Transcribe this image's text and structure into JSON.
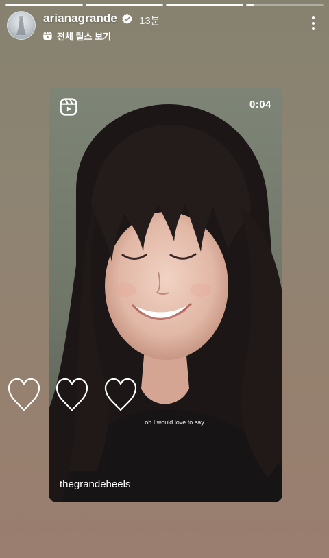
{
  "progress": [
    1,
    1,
    1,
    0.1
  ],
  "header": {
    "username": "arianagrande",
    "time": "13분",
    "reels_link": "전체 릴스 보기"
  },
  "reel": {
    "duration": "0:04",
    "caption": "oh I would love to say",
    "handle": "thegrandeheels"
  },
  "icons": {
    "verified": "verified-badge-icon",
    "reels": "reels-icon",
    "more": "more-vertical-icon",
    "heart": "heart-outline-icon"
  },
  "colors": {
    "background_top": "#86826f",
    "background_bottom": "#9a7e6f",
    "verified_check": "#86826f"
  }
}
